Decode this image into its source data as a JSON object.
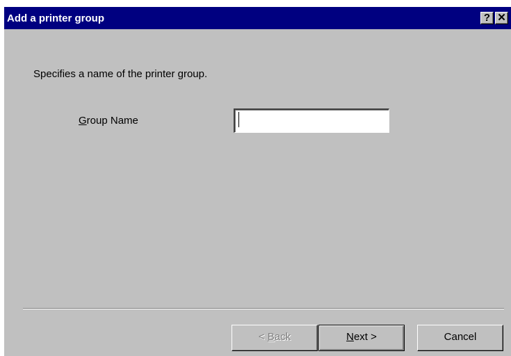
{
  "window": {
    "title": "Add a printer group",
    "help_glyph": "?",
    "close_glyph": "✕"
  },
  "form": {
    "description": "Specifies a name of the printer group.",
    "group_name_label_mnemonic": "G",
    "group_name_label_rest": "roup Name",
    "group_name_value": ""
  },
  "buttons": {
    "back_prefix": "< ",
    "back_mnemonic": "B",
    "back_rest": "ack",
    "next_mnemonic": "N",
    "next_rest": "ext >",
    "cancel_label": "Cancel"
  },
  "icons": {
    "help": "help-icon",
    "close": "close-icon"
  },
  "colors": {
    "titlebar": "#000080",
    "dialog_face": "#c0c0c0",
    "disabled_text": "#808080"
  }
}
